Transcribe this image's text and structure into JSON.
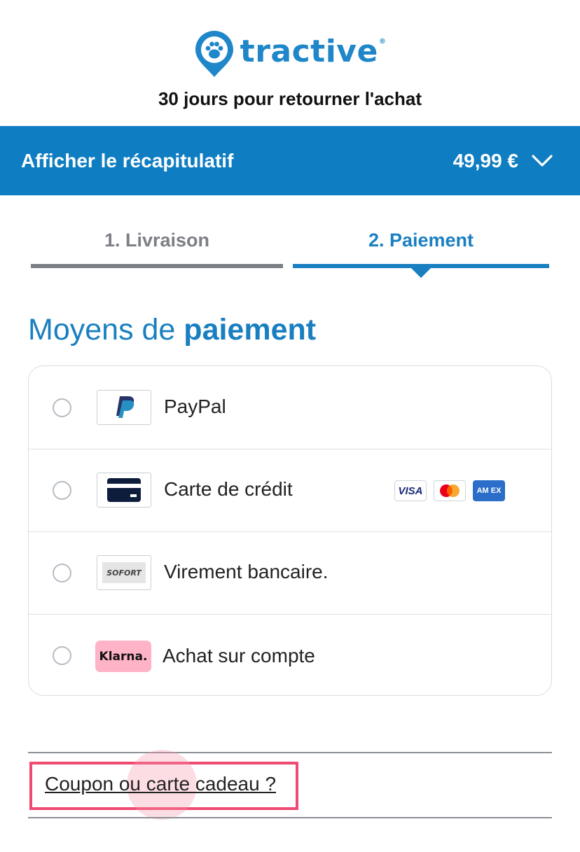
{
  "header": {
    "brand_name": "tractive",
    "brand_reg": "®",
    "brand_color": "#1f87c9",
    "tagline": "30 jours pour retourner l'achat",
    "logo_icon": "paw-pin-icon"
  },
  "summary_bar": {
    "label": "Afficher le récapitulatif",
    "total": "49,99 €",
    "icon": "chevron-down-icon",
    "bg_color": "#0e7dc2"
  },
  "steps": [
    {
      "label": "1. Livraison",
      "state": "done",
      "color": "#7c7f85"
    },
    {
      "label": "2. Paiement",
      "state": "active",
      "color": "#1a7fc1"
    }
  ],
  "section": {
    "title_light": "Moyens de ",
    "title_bold": "paiement"
  },
  "payment_methods": [
    {
      "label": "PayPal",
      "logo": "paypal-icon",
      "selected": false
    },
    {
      "label": "Carte de crédit",
      "logo": "credit-card-icon",
      "selected": false,
      "card_brands": [
        {
          "name": "visa-icon",
          "text": "VISA"
        },
        {
          "name": "mastercard-icon"
        },
        {
          "name": "amex-icon",
          "text": "AM EX"
        }
      ]
    },
    {
      "label": "Virement bancaire.",
      "logo": "sofort-icon",
      "logo_text": "SOFORT",
      "selected": false
    },
    {
      "label": "Achat sur compte",
      "logo": "klarna-icon",
      "logo_text": "Klarna.",
      "logo_bg": "#ffb3c7",
      "selected": false
    }
  ],
  "coupon": {
    "label": "Coupon ou carte cadeau ?",
    "highlight_color": "#ef4a72"
  }
}
